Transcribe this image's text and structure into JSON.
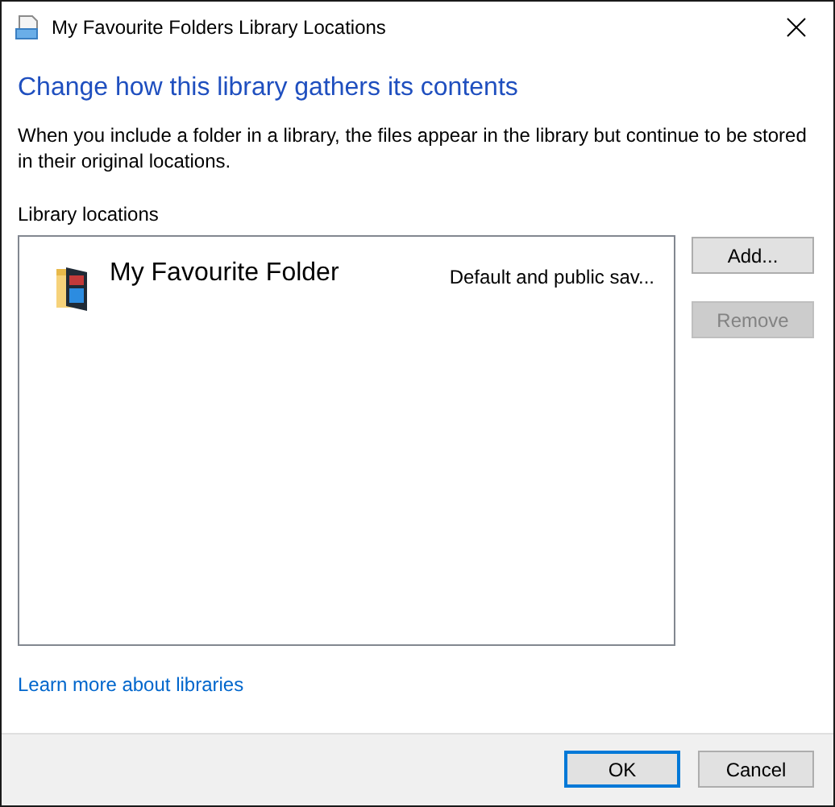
{
  "window": {
    "title": "My Favourite Folders Library Locations"
  },
  "heading": "Change how this library gathers its contents",
  "description": "When you include a folder in a library, the files appear in the library but continue to be stored in their original locations.",
  "locations_label": "Library locations",
  "locations": [
    {
      "name": "My Favourite Folder",
      "detail": "Default and public sav..."
    }
  ],
  "side_buttons": [
    {
      "label": "Add...",
      "disabled": false
    },
    {
      "label": "Remove",
      "disabled": true
    }
  ],
  "link": "Learn more about libraries",
  "footer_buttons": [
    {
      "label": "OK",
      "default": true
    },
    {
      "label": "Cancel",
      "default": false
    }
  ]
}
